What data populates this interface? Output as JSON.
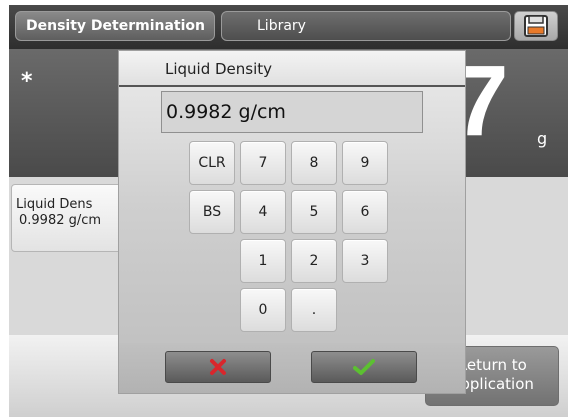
{
  "header": {
    "active_tab": "Density Determination",
    "library_tab": "Library",
    "save_icon": "floppy-disk-icon"
  },
  "display": {
    "indicator": "*",
    "reading_digit": "7",
    "unit": "g"
  },
  "parameter_card": {
    "label": "Liquid Dens",
    "value": "0.9982 g/cm"
  },
  "footer": {
    "return_line1": "Return to",
    "return_line2": "Application"
  },
  "dialog": {
    "title": "Liquid Density",
    "input_value": "0.9982 g/cm",
    "keys": {
      "clr": "CLR",
      "bs": "BS",
      "k7": "7",
      "k8": "8",
      "k9": "9",
      "k4": "4",
      "k5": "5",
      "k6": "6",
      "k1": "1",
      "k2": "2",
      "k3": "3",
      "k0": "0",
      "dot": "."
    },
    "cancel_icon": "red-x-icon",
    "confirm_icon": "green-check-icon",
    "colors": {
      "cancel": "#d9262c",
      "confirm": "#5cc031"
    }
  }
}
